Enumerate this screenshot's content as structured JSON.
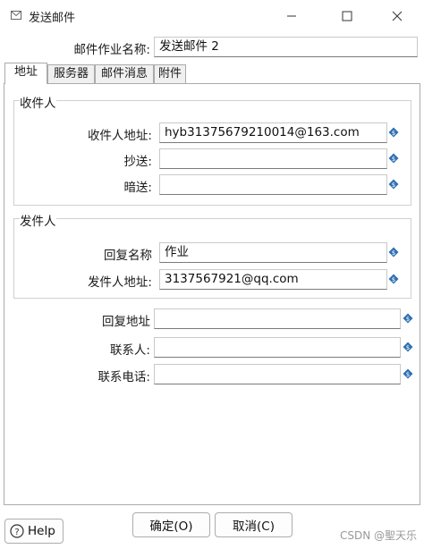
{
  "window": {
    "title": "发送邮件"
  },
  "task": {
    "label": "邮件作业名称:",
    "value": "发送邮件 2"
  },
  "tabs": [
    {
      "label": "地址",
      "active": true
    },
    {
      "label": "服务器",
      "active": false
    },
    {
      "label": "邮件消息",
      "active": false
    },
    {
      "label": "附件",
      "active": false
    }
  ],
  "recipients": {
    "title": "收件人",
    "to_label": "收件人地址:",
    "to_value": "hyb31375679210014@163.com",
    "cc_label": "抄送:",
    "cc_value": "",
    "bcc_label": "暗送:",
    "bcc_value": ""
  },
  "sender": {
    "title": "发件人",
    "reply_name_label": "回复名称",
    "reply_name_value": "作业",
    "from_label": "发件人地址:",
    "from_value": "3137567921@qq.com"
  },
  "other": {
    "reply_to_label": "回复地址",
    "reply_to_value": "",
    "contact_label": "联系人:",
    "contact_value": "",
    "phone_label": "联系电话:",
    "phone_value": ""
  },
  "buttons": {
    "help": "Help",
    "ok": "确定(O)",
    "cancel": "取消(C)"
  },
  "watermark": "CSDN @聖天乐",
  "icons": {
    "title": "mail-icon",
    "variable": "variable-diamond-icon",
    "help": "help-question-icon"
  },
  "colors": {
    "variable_icon": "#2f6fb0",
    "border": "#aaaaaa",
    "text": "#1a1a1a"
  }
}
